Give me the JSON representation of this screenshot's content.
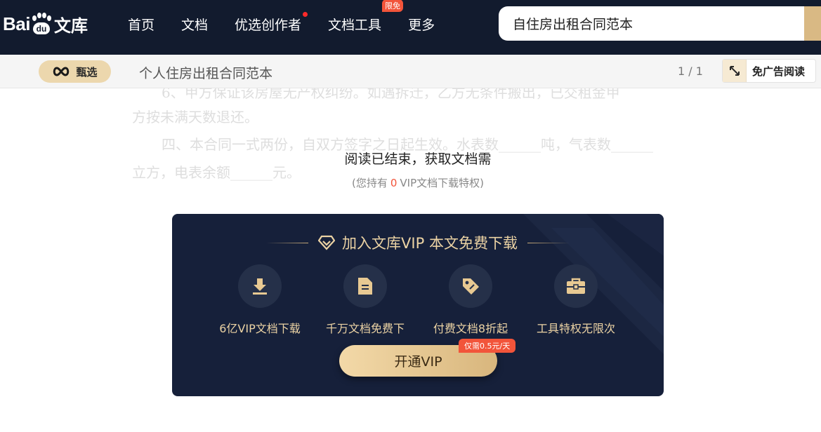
{
  "logo": {
    "text_left": "Bai",
    "text_paw": "du",
    "text_right": "文库"
  },
  "nav": {
    "items": [
      {
        "label": "首页"
      },
      {
        "label": "文档"
      },
      {
        "label": "优选创作者",
        "has_dot": true
      },
      {
        "label": "文档工具",
        "badge": "限免"
      },
      {
        "label": "更多"
      }
    ]
  },
  "search": {
    "value": "自住房出租合同范本"
  },
  "subbar": {
    "pick_label": "甄选",
    "doc_title": "个人住房出租合同范本",
    "page_count": "1 / 1",
    "ad_free_label": "免广告阅读"
  },
  "document": {
    "lines": [
      "6、甲方保证该房屋无产权纠纷。如遇拆迁，乙方无条件搬出，已交租金甲",
      "方按未满天数退还。",
      "四、本合同一式两份，自双方签字之日起生效。水表数______吨，气表数______",
      "立方，电表余额______元。"
    ]
  },
  "end_notice": {
    "message": "阅读已结束，获取文档需",
    "vip_hold_prefix": "(您持有",
    "vip_hold_count": "0",
    "vip_hold_suffix": "VIP文档下载特权)"
  },
  "vip_card": {
    "title": "加入文库VIP 本文免费下载",
    "features": [
      {
        "icon": "download-icon",
        "label": "6亿VIP文档下载"
      },
      {
        "icon": "document-icon",
        "label": "千万文档免费下"
      },
      {
        "icon": "price-tag-icon",
        "label": "付费文档8折起"
      },
      {
        "icon": "toolbox-icon",
        "label": "工具特权无限次"
      }
    ],
    "button_label": "开通VIP",
    "promo_badge": "仅需0.5元/天"
  },
  "colors": {
    "nav_bg": "#121b2e",
    "gold": "#ecd3a4",
    "accent_red": "#f2543a",
    "card_bg": "#16203a"
  }
}
